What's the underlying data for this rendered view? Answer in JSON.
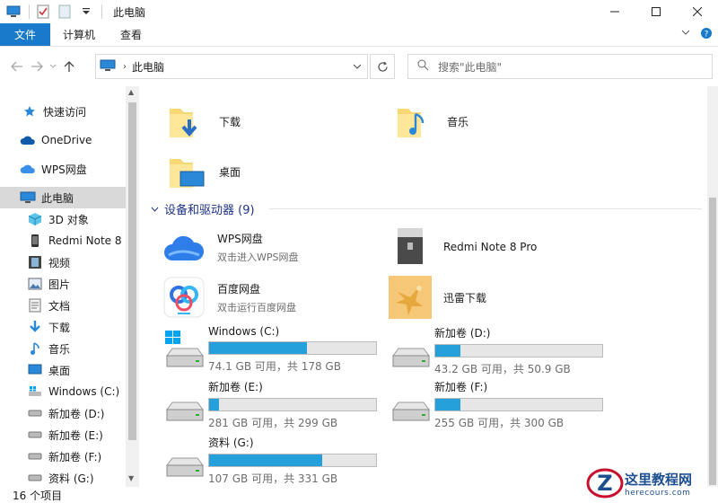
{
  "window": {
    "title": "此电脑"
  },
  "ribbon": {
    "tabs": [
      "文件",
      "计算机",
      "查看"
    ]
  },
  "address": {
    "crumb": "此电脑",
    "search_placeholder": "搜索\"此电脑\""
  },
  "sidebar": {
    "items": [
      {
        "label": "快速访问",
        "icon": "star-icon"
      },
      {
        "label": "OneDrive",
        "icon": "cloud-icon"
      },
      {
        "label": "WPS网盘",
        "icon": "cloud-icon"
      },
      {
        "label": "此电脑",
        "icon": "pc-icon"
      },
      {
        "label": "3D 对象",
        "icon": "cube-icon"
      },
      {
        "label": "Redmi Note 8",
        "icon": "phone-icon"
      },
      {
        "label": "视频",
        "icon": "film-icon"
      },
      {
        "label": "图片",
        "icon": "picture-icon"
      },
      {
        "label": "文档",
        "icon": "document-icon"
      },
      {
        "label": "下载",
        "icon": "download-icon"
      },
      {
        "label": "音乐",
        "icon": "music-icon"
      },
      {
        "label": "桌面",
        "icon": "desktop-icon"
      },
      {
        "label": "Windows (C:)",
        "icon": "drive-icon"
      },
      {
        "label": "新加卷 (D:)",
        "icon": "drive-icon"
      },
      {
        "label": "新加卷 (E:)",
        "icon": "drive-icon"
      },
      {
        "label": "新加卷 (F:)",
        "icon": "drive-icon"
      },
      {
        "label": "资料 (G:)",
        "icon": "drive-icon"
      }
    ]
  },
  "folders": [
    {
      "name": "下载",
      "icon": "download-folder-icon"
    },
    {
      "name": "音乐",
      "icon": "music-folder-icon"
    },
    {
      "name": "桌面",
      "icon": "desktop-folder-icon"
    }
  ],
  "devices_group": {
    "title": "设备和驱动器 (9)"
  },
  "devices": [
    {
      "name": "WPS网盘",
      "sub": "双击进入WPS网盘"
    },
    {
      "name": "Redmi Note 8 Pro",
      "sub": ""
    },
    {
      "name": "百度网盘",
      "sub": "双击运行百度网盘"
    },
    {
      "name": "迅雷下载",
      "sub": ""
    }
  ],
  "drives": [
    {
      "name": "Windows (C:)",
      "free": "74.1 GB 可用，共 178 GB",
      "used_fraction": 0.584
    },
    {
      "name": "新加卷 (D:)",
      "free": "43.2 GB 可用，共 50.9 GB",
      "used_fraction": 0.151
    },
    {
      "name": "新加卷 (E:)",
      "free": "281 GB 可用，共 299 GB",
      "used_fraction": 0.06
    },
    {
      "name": "新加卷 (F:)",
      "free": "255 GB 可用，共 300 GB",
      "used_fraction": 0.15
    },
    {
      "name": "资料 (G:)",
      "free": "107 GB 可用，共 331 GB",
      "used_fraction": 0.677
    }
  ],
  "status": {
    "count": "16 个项目"
  },
  "watermark": {
    "title": "这里教程网",
    "url": "herecours.com"
  },
  "colors": {
    "accent": "#1979ca",
    "bar_fill": "#26a0da",
    "group_heading": "#1e3287"
  }
}
